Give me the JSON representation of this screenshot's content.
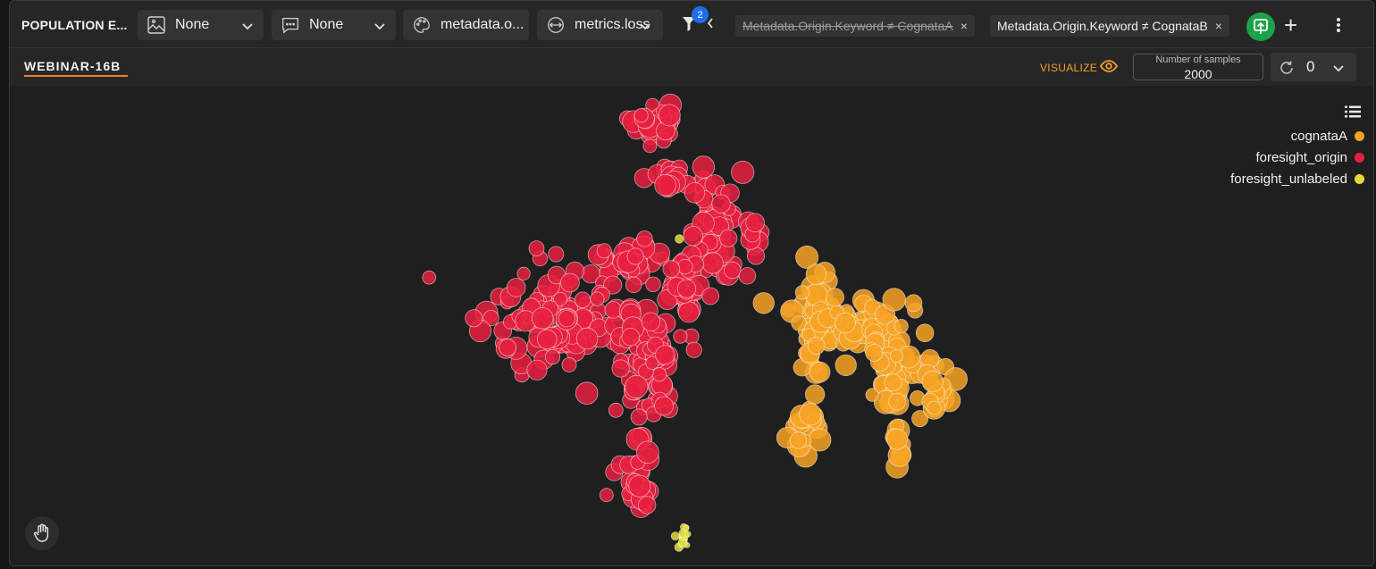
{
  "header": {
    "app_title": "POPULATION E...",
    "selectors": [
      {
        "label": "None",
        "icon": "image-icon"
      },
      {
        "label": "None",
        "icon": "comment-icon"
      },
      {
        "label": "metadata.o...",
        "icon": "palette-icon"
      },
      {
        "label": "metrics.loss",
        "icon": "size-icon"
      }
    ],
    "filter_count": "2",
    "filters": [
      {
        "label": "Metadata.Origin.Keyword ≠ CognataA",
        "disabled": true
      },
      {
        "label": "Metadata.Origin.Keyword ≠ CognataB",
        "disabled": false
      }
    ],
    "close_glyph": "×",
    "plus_glyph": "+"
  },
  "subbar": {
    "project_name": "WEBINAR-16B",
    "visualize_label": "VISUALIZE",
    "samples_label": "Number of samples",
    "samples_value": "2000",
    "refresh_count": "0"
  },
  "legend": {
    "items": [
      {
        "label": "cognataA",
        "color": "#f7a325"
      },
      {
        "label": "foresight_origin",
        "color": "#e8203f"
      },
      {
        "label": "foresight_unlabeled",
        "color": "#e3dc35"
      }
    ]
  },
  "chart_data": {
    "type": "scatter",
    "title": "",
    "xlabel": "",
    "ylabel": "",
    "grid": false,
    "legend_position": "top-right",
    "series": [
      {
        "name": "foresight_origin",
        "color": "#e8203f",
        "clusters": [
          {
            "cx": 722,
            "cy": 42,
            "sx": 15,
            "sy": 12,
            "n": 30
          },
          {
            "cx": 740,
            "cy": 105,
            "sx": 26,
            "sy": 6,
            "n": 22
          },
          {
            "cx": 790,
            "cy": 158,
            "sx": 15,
            "sy": 28,
            "n": 55
          },
          {
            "cx": 755,
            "cy": 228,
            "sx": 11,
            "sy": 28,
            "n": 32
          },
          {
            "cx": 699,
            "cy": 197,
            "sx": 14,
            "sy": 11,
            "n": 34
          },
          {
            "cx": 605,
            "cy": 260,
            "sx": 40,
            "sy": 30,
            "n": 110
          },
          {
            "cx": 710,
            "cy": 310,
            "sx": 17,
            "sy": 40,
            "n": 75
          },
          {
            "cx": 702,
            "cy": 440,
            "sx": 12,
            "sy": 17,
            "n": 30
          },
          {
            "cx": 832,
            "cy": 168,
            "sx": 5,
            "sy": 9,
            "n": 9
          },
          {
            "cx": 667,
            "cy": 190,
            "sx": 4,
            "sy": 3,
            "n": 3
          }
        ]
      },
      {
        "name": "cognataA",
        "color": "#f7a325",
        "clusters": [
          {
            "cx": 900,
            "cy": 272,
            "sx": 14,
            "sy": 35,
            "n": 60
          },
          {
            "cx": 885,
            "cy": 380,
            "sx": 14,
            "sy": 17,
            "n": 20
          },
          {
            "cx": 960,
            "cy": 265,
            "sx": 20,
            "sy": 13,
            "n": 40
          },
          {
            "cx": 990,
            "cy": 320,
            "sx": 16,
            "sy": 28,
            "n": 50
          },
          {
            "cx": 1040,
            "cy": 345,
            "sx": 9,
            "sy": 12,
            "n": 22
          },
          {
            "cx": 995,
            "cy": 395,
            "sx": 6,
            "sy": 15,
            "n": 14
          }
        ]
      },
      {
        "name": "foresight_unlabeled",
        "color": "#e3dc35",
        "clusters": [
          {
            "cx": 752,
            "cy": 505,
            "sx": 4,
            "sy": 6,
            "n": 16
          },
          {
            "cx": 750,
            "cy": 170,
            "sx": 1,
            "sy": 1,
            "n": 1
          }
        ]
      }
    ]
  }
}
